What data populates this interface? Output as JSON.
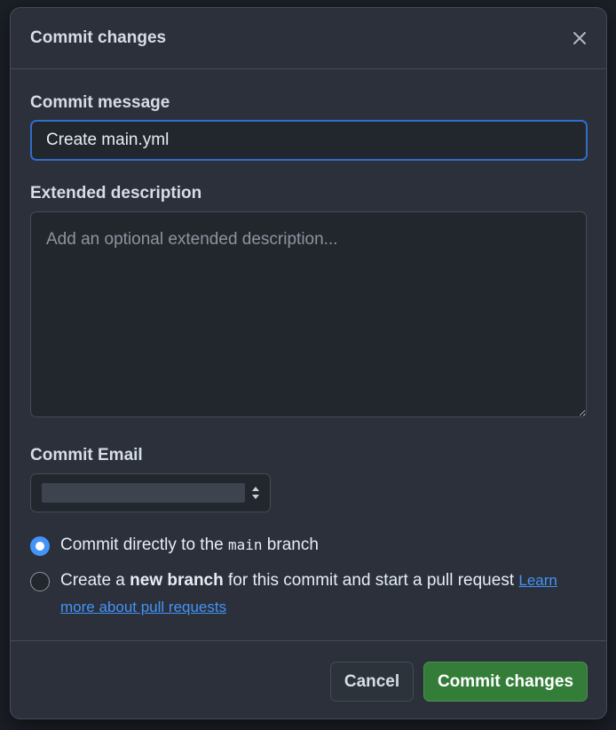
{
  "dialog": {
    "title": "Commit changes",
    "close_icon": "close-icon"
  },
  "commit_message": {
    "label": "Commit message",
    "value": "Create main.yml"
  },
  "extended_description": {
    "label": "Extended description",
    "placeholder": "Add an optional extended description...",
    "value": ""
  },
  "commit_email": {
    "label": "Commit Email",
    "selected_value": ""
  },
  "branch_options": {
    "direct": {
      "prefix": "Commit directly to the ",
      "branch": "main",
      "suffix": " branch",
      "checked": true
    },
    "new_branch": {
      "prefix": "Create a ",
      "bold": "new branch",
      "suffix": " for this commit and start a pull request ",
      "link": "Learn more about pull requests",
      "checked": false
    }
  },
  "footer": {
    "cancel_label": "Cancel",
    "commit_label": "Commit changes"
  },
  "colors": {
    "accent": "#4493f8",
    "primary_button": "#347d39",
    "focus_border": "#316dca"
  }
}
